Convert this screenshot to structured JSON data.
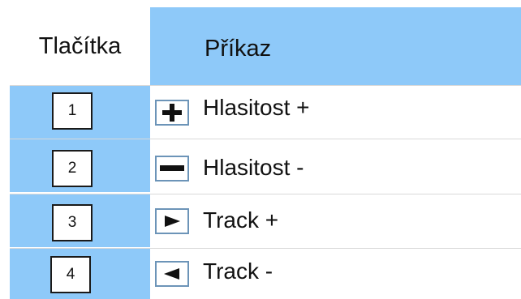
{
  "header": {
    "col_buttons": "Tlačítka",
    "col_command": "Příkaz"
  },
  "rows": [
    {
      "number": "1",
      "icon": "plus-icon",
      "label": "Hlasitost +"
    },
    {
      "number": "2",
      "icon": "minus-icon",
      "label": "Hlasitost -"
    },
    {
      "number": "3",
      "icon": "right-triangle-icon",
      "label": "Track +"
    },
    {
      "number": "4",
      "icon": "left-triangle-icon",
      "label": "Track -"
    }
  ],
  "colors": {
    "header_blue": "#8ec9f9",
    "icon_border": "#6c94b8"
  }
}
